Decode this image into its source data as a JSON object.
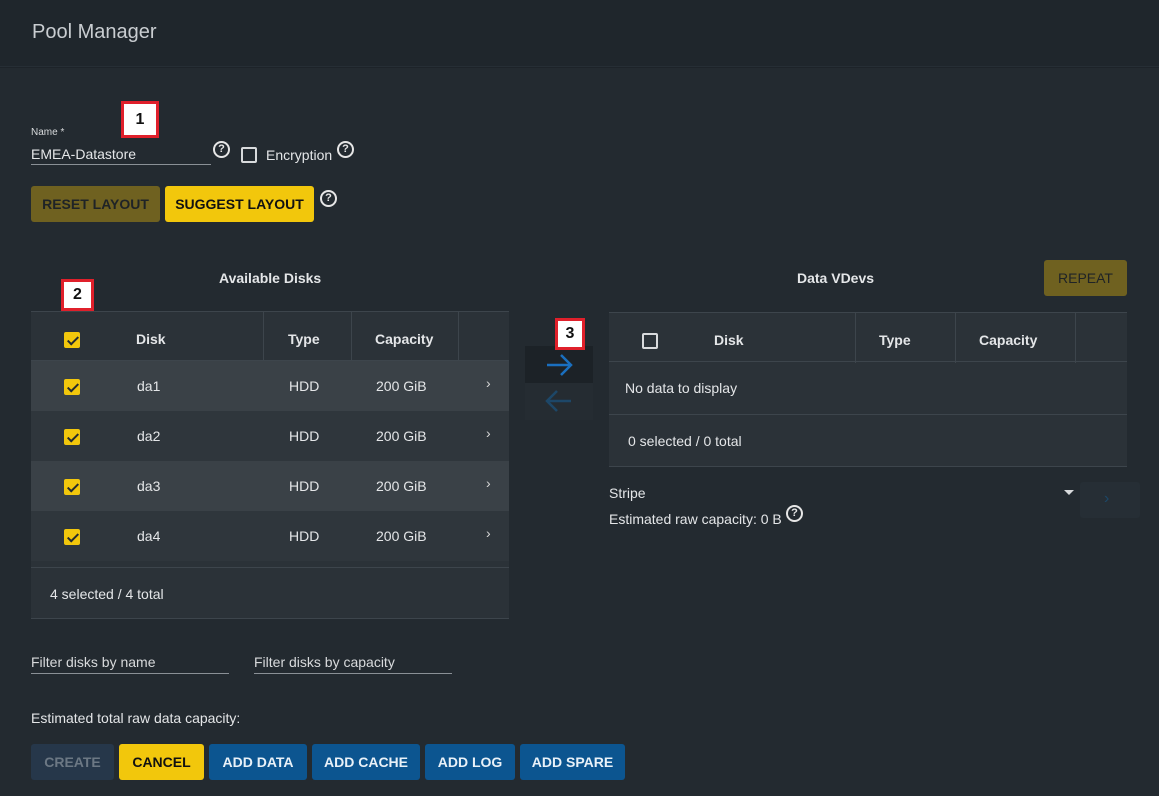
{
  "window": {
    "title": "Pool Manager"
  },
  "form": {
    "name_label": "Name *",
    "name_value": "EMEA-Datastore",
    "encryption_label": "Encryption",
    "help_glyph": "?"
  },
  "buttons": {
    "reset_layout": "RESET LAYOUT",
    "suggest_layout": "SUGGEST LAYOUT",
    "repeat": "REPEAT",
    "create": "CREATE",
    "cancel": "CANCEL",
    "add_data": "ADD DATA",
    "add_cache": "ADD CACHE",
    "add_log": "ADD LOG",
    "add_spare": "ADD SPARE"
  },
  "available": {
    "title": "Available Disks",
    "columns": [
      "Disk",
      "Type",
      "Capacity"
    ],
    "rows": [
      {
        "disk": "da1",
        "type": "HDD",
        "capacity": "200 GiB",
        "selected": true
      },
      {
        "disk": "da2",
        "type": "HDD",
        "capacity": "200 GiB",
        "selected": true
      },
      {
        "disk": "da3",
        "type": "HDD",
        "capacity": "200 GiB",
        "selected": true
      },
      {
        "disk": "da4",
        "type": "HDD",
        "capacity": "200 GiB",
        "selected": true
      }
    ],
    "footer": "4 selected / 4 total",
    "chevron": "›"
  },
  "vdevs": {
    "title": "Data VDevs",
    "columns": [
      "Disk",
      "Type",
      "Capacity"
    ],
    "empty_text": "No data to display",
    "footer": "0 selected / 0 total",
    "layout_value": "Stripe",
    "raw_capacity": "Estimated raw capacity: 0 B"
  },
  "filters": {
    "by_name_placeholder": "Filter disks by name",
    "by_capacity_placeholder": "Filter disks by capacity"
  },
  "summary": {
    "total_capacity_label": "Estimated total raw data capacity:"
  },
  "annotations": {
    "badge1": "1",
    "badge2": "2",
    "badge3": "3"
  },
  "icons": {
    "move_right": "arrow-right-icon",
    "move_left": "arrow-left-icon",
    "dropdown": "caret-down-icon",
    "help": "help-circle-icon"
  },
  "colors": {
    "accent_yellow": "#f2c70c",
    "accent_blue": "#0c5590",
    "marker_red": "#e0202b"
  }
}
